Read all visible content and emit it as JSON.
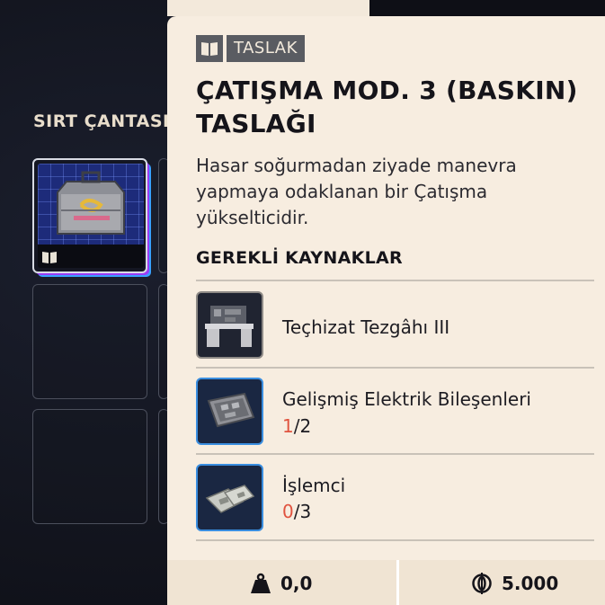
{
  "inventory": {
    "title": "SIRT ÇANTASI"
  },
  "panel": {
    "tag": {
      "icon": "book-icon",
      "label": "TASLAK"
    },
    "title_line1": "ÇATIŞMA MOD. 3 (BASKIN)",
    "title_line2": "TASLAĞI",
    "description_line1": "Hasar soğurmadan ziyade manevra",
    "description_line2": "yapmaya odaklanan bir Çatışma",
    "description_line3": "yükselticidir.",
    "resources_heading": "GEREKLİ KAYNAKLAR",
    "resources": [
      {
        "name": "Teçhizat Tezgâhı III",
        "icon": "workbench-icon"
      },
      {
        "name": "Gelişmiş Elektrik Bileşenleri",
        "have": "1",
        "need": "/2",
        "icon": "electrical-components-icon"
      },
      {
        "name": "İşlemci",
        "have": "0",
        "need": "/3",
        "icon": "processor-icon"
      }
    ]
  },
  "footer": {
    "weight_icon": "weight-icon",
    "weight": "0,0",
    "currency_icon": "coin-icon",
    "price": "5.000"
  },
  "colors": {
    "panel_bg": "#f7ede0",
    "missing_count": "#e0533f",
    "tag_bg": "#5a5c62",
    "rarity_glow_purple": "#9b3cf5",
    "rarity_glow_blue": "#3aa0ff"
  }
}
